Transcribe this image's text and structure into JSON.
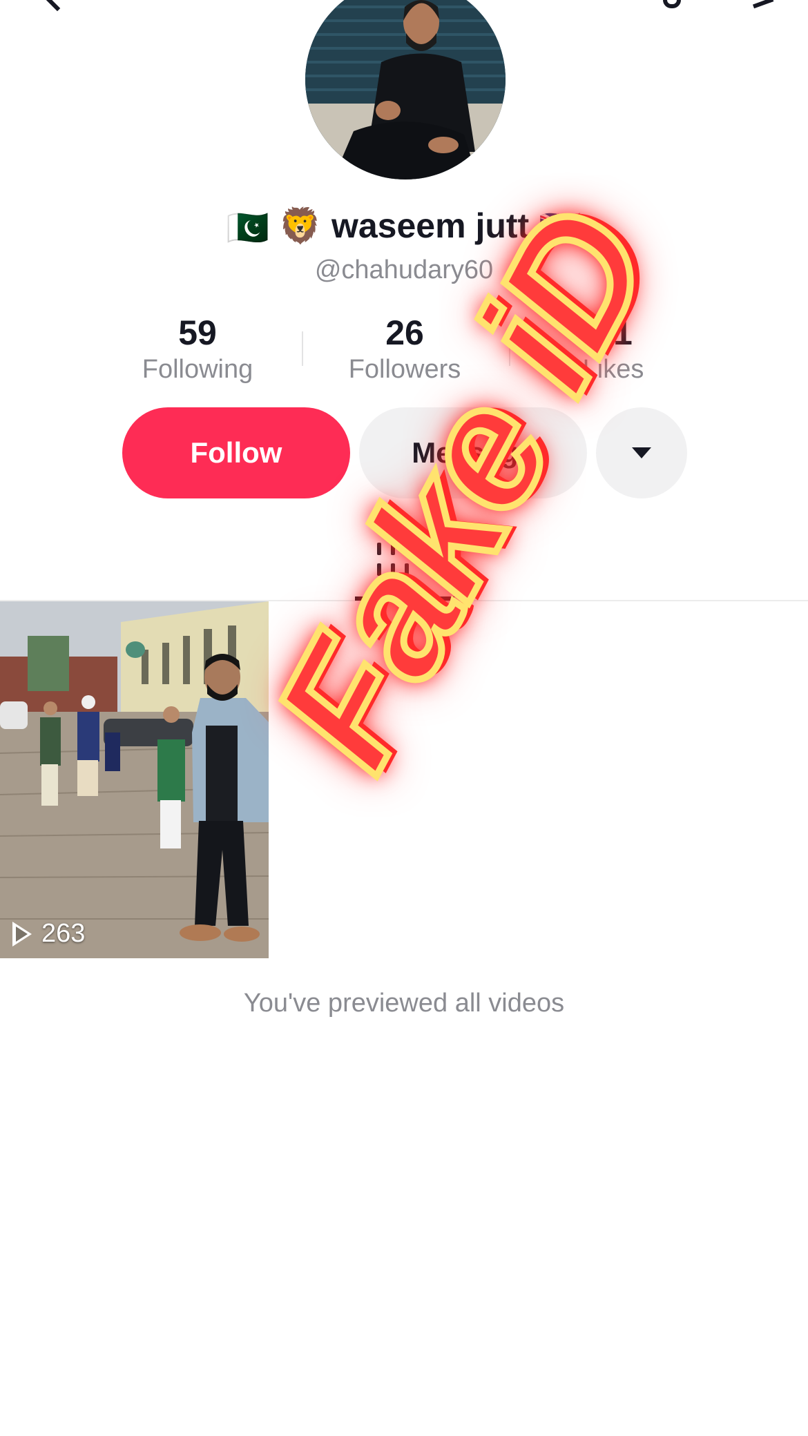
{
  "profile": {
    "display_name": "waseem jutt",
    "flag_left": "🇵🇰",
    "emoji": "🦁",
    "flag_right": "🇬🇧",
    "handle": "@chahudary60"
  },
  "stats": {
    "following": {
      "value": "59",
      "label": "Following"
    },
    "followers": {
      "value": "26",
      "label": "Followers"
    },
    "likes": {
      "value": "41",
      "label": "Likes"
    }
  },
  "actions": {
    "follow_label": "Follow",
    "message_label": "Message",
    "more_icon": "caret-down-icon"
  },
  "tabs": {
    "active_icon": "videos-grid-icon"
  },
  "videos": [
    {
      "views": "263"
    }
  ],
  "preview_message": "You've previewed all videos",
  "watermark": "Fake iD",
  "colors": {
    "accent": "#fe2c55",
    "secondary_button": "#f1f1f2",
    "muted_text": "#8a8b91",
    "watermark_fill": "#ff3b3b",
    "watermark_outline": "#ffe36e"
  }
}
